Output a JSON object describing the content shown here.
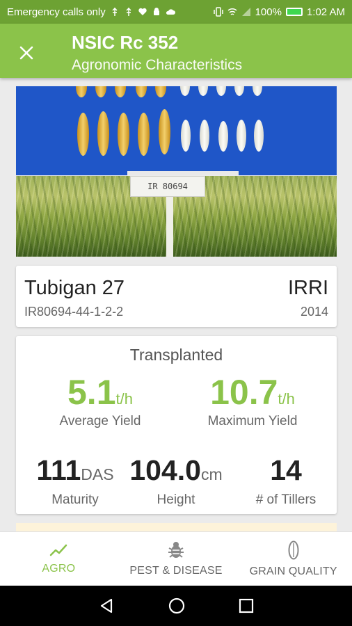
{
  "status_bar": {
    "carrier": "Emergency calls only",
    "battery": "100%",
    "time": "1:02 AM"
  },
  "header": {
    "title": "NSIC Rc 352",
    "subtitle": "Agronomic Characteristics",
    "close_icon": "close-icon"
  },
  "field_sign_text": "IR 80694",
  "variety": {
    "name": "Tubigan 27",
    "code": "IR80694-44-1-2-2",
    "organization": "IRRI",
    "year": "2014"
  },
  "stats": {
    "method": "Transplanted",
    "average_yield": {
      "value": "5.1",
      "unit": "t/h",
      "label": "Average Yield"
    },
    "maximum_yield": {
      "value": "10.7",
      "unit": "t/h",
      "label": "Maximum Yield"
    },
    "maturity": {
      "value": "111",
      "unit": "DAS",
      "label": "Maturity"
    },
    "height": {
      "value": "104.0",
      "unit": "cm",
      "label": "Height"
    },
    "tillers": {
      "value": "14",
      "unit": "",
      "label": "# of Tillers"
    }
  },
  "bottom_nav": [
    {
      "label": "AGRO",
      "icon": "trend-line-icon",
      "active": true
    },
    {
      "label": "PEST & DISEASE",
      "icon": "bug-icon",
      "active": false
    },
    {
      "label": "GRAIN QUALITY",
      "icon": "grain-icon",
      "active": false
    }
  ],
  "colors": {
    "status_bar": "#6da233",
    "app_bar": "#8bc34a",
    "accent": "#8bc34a",
    "background": "#ebebeb"
  }
}
